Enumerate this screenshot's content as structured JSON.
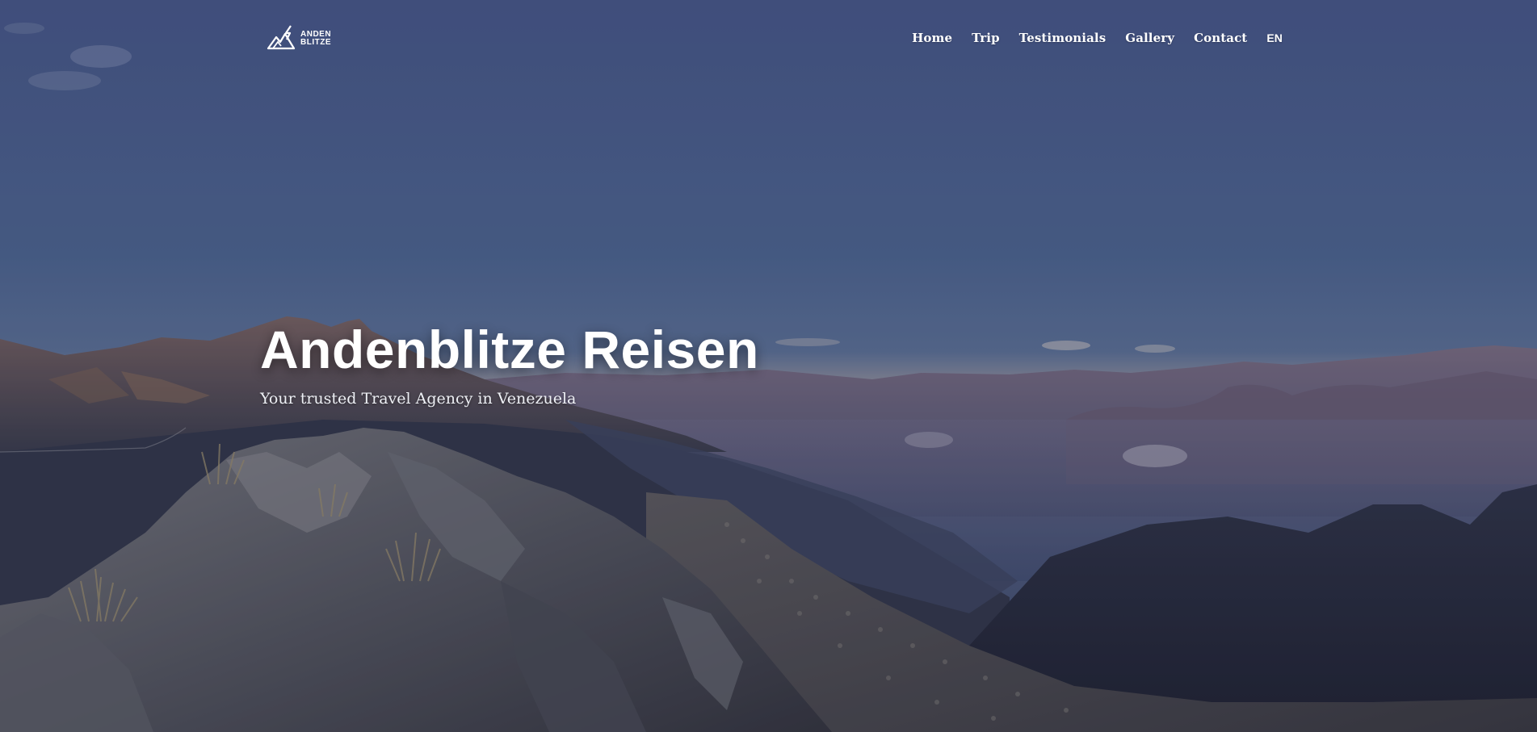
{
  "brand": {
    "logo_line1": "ANDEN",
    "logo_line2": "BLITZE",
    "logo_icon": "mountain-lightning-icon"
  },
  "nav": {
    "items": [
      {
        "label": "Home"
      },
      {
        "label": "Trip"
      },
      {
        "label": "Testimonials"
      },
      {
        "label": "Gallery"
      },
      {
        "label": "Contact"
      }
    ],
    "language": "EN"
  },
  "hero": {
    "title": "Andenblitze Reisen",
    "subtitle": "Your trusted Travel Agency in Venezuela"
  },
  "colors": {
    "sky_top": "#4a5d88",
    "sky_horizon": "#6f7fa1",
    "mountain_dark": "#2b2f3e",
    "rock": "#6b6e74",
    "text": "#ffffff"
  }
}
